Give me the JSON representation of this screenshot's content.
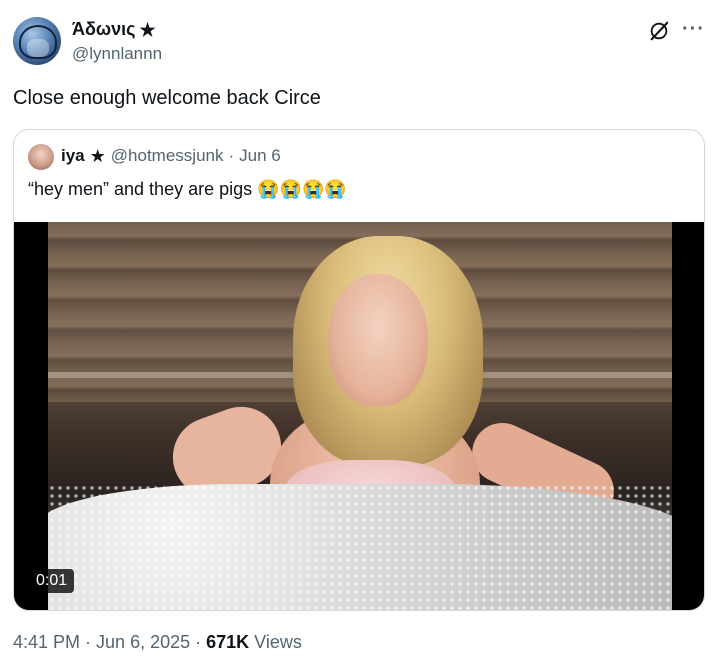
{
  "tweet": {
    "display_name": "Άδωνις",
    "star": "★",
    "handle": "@lynnlannn",
    "text": "Close enough welcome back Circe",
    "more": "···",
    "time": "4:41 PM",
    "sep1": "·",
    "date": "Jun 6, 2025",
    "sep2": "·",
    "views_count": "671K",
    "views_label": "Views"
  },
  "quote": {
    "name": "iya",
    "star": "★",
    "handle": "@hotmessjunk",
    "sep": "·",
    "date": "Jun 6",
    "text": "“hey men” and they are pigs 😭😭😭😭",
    "video_time": "0:01"
  }
}
